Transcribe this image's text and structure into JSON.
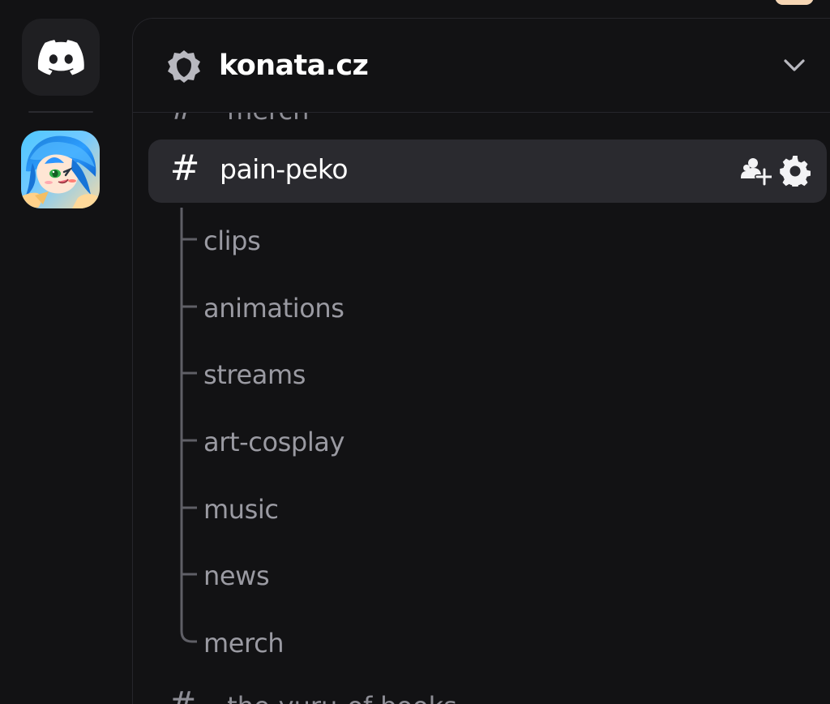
{
  "server_rail": {
    "home_icon": "discord-logo-icon",
    "server_avatar": "anime-server-avatar"
  },
  "guild": {
    "name": "konata.cz",
    "badge_icon": "guild-shield-icon",
    "menu_icon": "chevron-down-icon"
  },
  "channel_list": {
    "partial_top_channel": "merch",
    "selected_channel": {
      "name": "pain-peko",
      "channel_icon": "hash-icon",
      "actions": {
        "invite_icon": "invite-people-icon",
        "settings_icon": "gear-icon"
      }
    },
    "threads": [
      "clips",
      "animations",
      "streams",
      "art-cosplay",
      "music",
      "news",
      "merch"
    ],
    "partial_bottom_channel": "the-yuru-of-books"
  },
  "colors": {
    "background": "#121214",
    "selected_row": "#2a2a2f",
    "primary_text": "#ffffff",
    "muted_text": "#9a9aa2",
    "divider": "#26262b"
  }
}
